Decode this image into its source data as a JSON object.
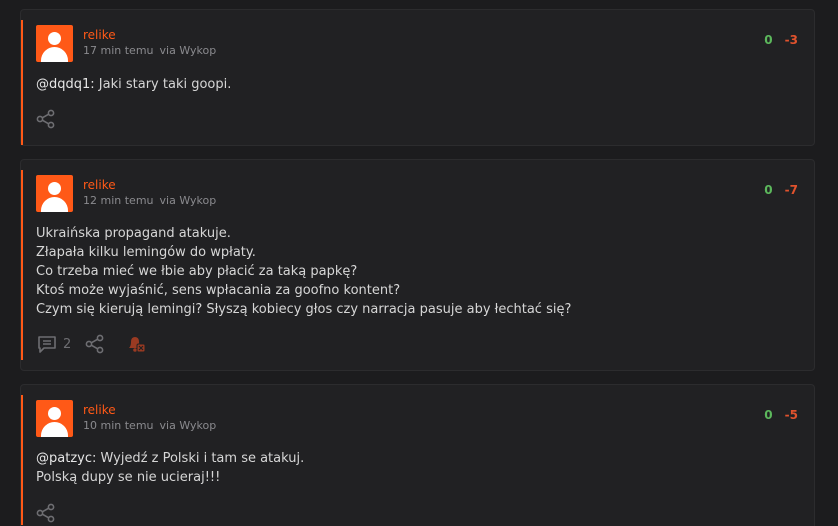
{
  "posts": [
    {
      "author": "relike",
      "time": "17 min temu",
      "via": "via Wykop",
      "votes_up": "0",
      "votes_down": "-3",
      "mention": "@dqdq1:",
      "text": " Jaki stary taki goopi."
    },
    {
      "author": "relike",
      "time": "12 min temu",
      "via": "via Wykop",
      "votes_up": "0",
      "votes_down": "-7",
      "lines": [
        "Ukraińska propagand atakuje.",
        "Złapała kilku lemingów do wpłaty.",
        "Co trzeba mieć we łbie aby płacić za taką papkę?",
        "Ktoś może wyjaśnić, sens wpłacania za goofno kontent?",
        "Czym się kierują lemingi? Słyszą kobiecy głos czy narracja pasuje aby łechtać się?"
      ],
      "comments_count": "2"
    },
    {
      "author": "relike",
      "time": "10 min temu",
      "via": "via Wykop",
      "votes_up": "0",
      "votes_down": "-5",
      "mention": "@patzyc:",
      "text": " Wyjedź z Polski i tam se atakuj.",
      "line2": "Polską dupy se nie ucieraj!!!"
    }
  ],
  "icons": {
    "share": "share-icon",
    "comments": "comments-icon",
    "report": "report-bell-icon"
  },
  "colors": {
    "accent": "#ff5917",
    "upvote": "#5cb85c",
    "downvote": "#e0522d",
    "background": "#1c1c1e",
    "card": "#212123"
  }
}
